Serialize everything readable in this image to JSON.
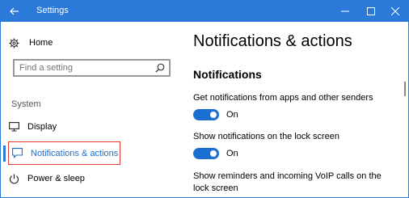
{
  "window": {
    "title": "Settings",
    "accent_color": "#2b79d9",
    "controls": [
      "back-icon",
      "minimize-icon",
      "maximize-icon",
      "close-icon"
    ]
  },
  "sidebar": {
    "home_label": "Home",
    "home_icon": "gear-icon",
    "search_placeholder": "Find a setting",
    "search_icon": "search-icon",
    "section_label": "System",
    "items": [
      {
        "label": "Display",
        "icon": "monitor-icon",
        "selected": false
      },
      {
        "label": "Notifications & actions",
        "icon": "message-icon",
        "selected": true,
        "highlight_color": "#e53935"
      },
      {
        "label": "Power & sleep",
        "icon": "power-icon",
        "selected": false
      }
    ]
  },
  "main": {
    "page_title": "Notifications & actions",
    "section_title": "Notifications",
    "settings": [
      {
        "label": "Get notifications from apps and other senders",
        "toggle_state": "On",
        "on": true
      },
      {
        "label": "Show notifications on the lock screen",
        "toggle_state": "On",
        "on": true
      },
      {
        "label": "Show reminders and incoming VoIP calls on the lock screen"
      }
    ],
    "toggle_color": "#1a6fd0"
  }
}
